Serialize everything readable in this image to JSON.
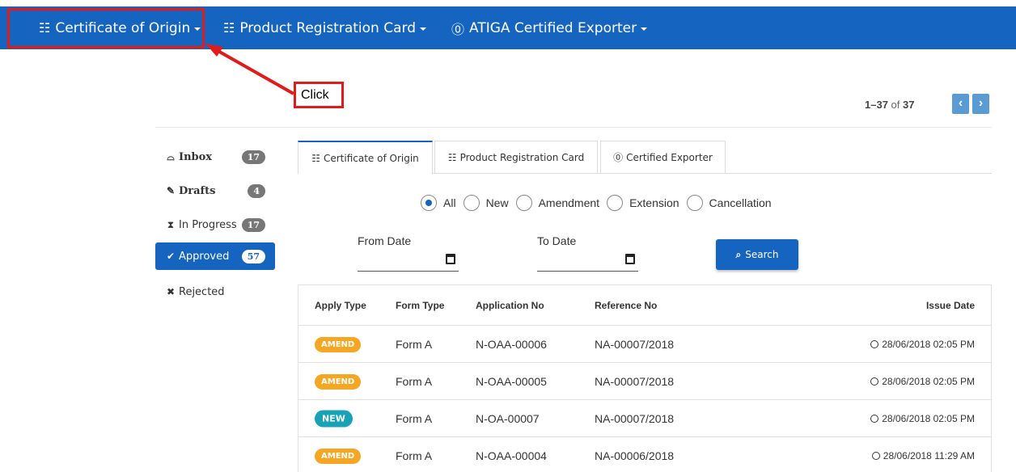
{
  "topnav": {
    "items": [
      {
        "label": "Certificate of Origin",
        "icon": "certificate-icon"
      },
      {
        "label": "Product Registration Card",
        "icon": "registration-card-icon"
      },
      {
        "label": "ATIGA Certified Exporter",
        "icon": "certified-exporter-icon"
      }
    ]
  },
  "annotation": {
    "label": "Click"
  },
  "pager": {
    "range": "1–37",
    "of_label": "of",
    "total": "37"
  },
  "sidebar": {
    "items": [
      {
        "label": "Inbox",
        "count": "17",
        "icon": "inbox-icon"
      },
      {
        "label": "Drafts",
        "count": "4",
        "icon": "edit-icon"
      },
      {
        "label": "In Progress",
        "count": "17",
        "icon": "hourglass-icon"
      },
      {
        "label": "Approved",
        "count": "57",
        "icon": "check-circle-icon"
      },
      {
        "label": "Rejected",
        "icon": "times-circle-icon"
      }
    ]
  },
  "tabs": [
    {
      "label": "Certificate of Origin",
      "icon": "certificate-icon"
    },
    {
      "label": "Product Registration Card",
      "icon": "registration-card-icon"
    },
    {
      "label": "Certified Exporter",
      "icon": "certified-exporter-icon"
    }
  ],
  "filters": {
    "options": [
      "All",
      "New",
      "Amendment",
      "Extension",
      "Cancellation"
    ],
    "selected": "All"
  },
  "dates": {
    "from_label": "From Date",
    "to_label": "To Date"
  },
  "search": {
    "label": "Search"
  },
  "table": {
    "headers": [
      "Apply Type",
      "Form Type",
      "Application No",
      "Reference No",
      "Issue Date"
    ],
    "rows": [
      {
        "apply_type": "AMEND",
        "form_type": "Form A",
        "application_no": "N-OAA-00006",
        "reference_no": "NA-00007/2018",
        "issue_date": "28/06/2018 02:05 PM"
      },
      {
        "apply_type": "AMEND",
        "form_type": "Form A",
        "application_no": "N-OAA-00005",
        "reference_no": "NA-00007/2018",
        "issue_date": "28/06/2018 02:05 PM"
      },
      {
        "apply_type": "NEW",
        "form_type": "Form A",
        "application_no": "N-OA-00007",
        "reference_no": "NA-00007/2018",
        "issue_date": "28/06/2018 02:05 PM"
      },
      {
        "apply_type": "AMEND",
        "form_type": "Form A",
        "application_no": "N-OAA-00004",
        "reference_no": "NA-00006/2018",
        "issue_date": "28/06/2018 11:29 AM"
      }
    ]
  },
  "colors": {
    "primary": "#1565c0",
    "amend": "#f5a623",
    "new": "#17a2b8",
    "highlight": "#e01b1b"
  }
}
